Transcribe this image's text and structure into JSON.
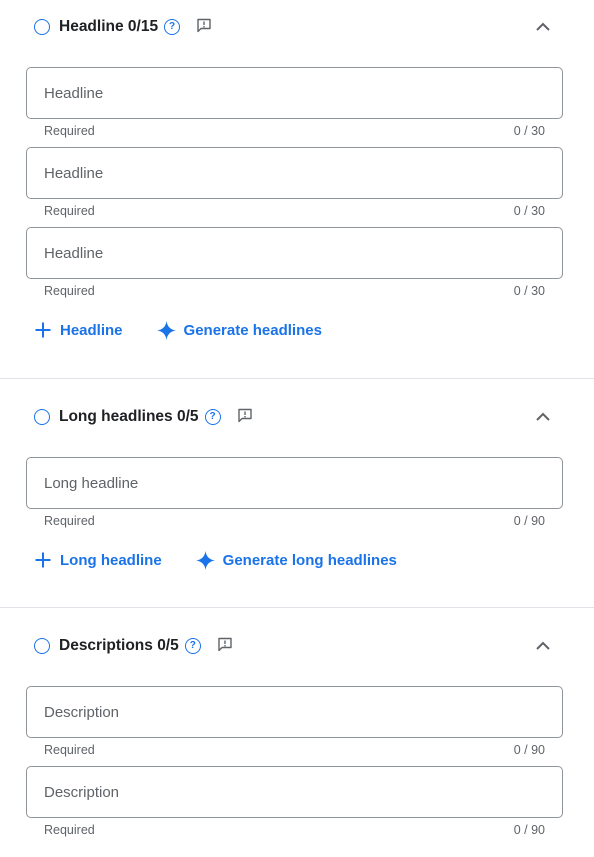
{
  "headline_section": {
    "title": "Headline 0/15",
    "fields": [
      {
        "placeholder": "Headline",
        "hint": "Required",
        "counter": "0 / 30"
      },
      {
        "placeholder": "Headline",
        "hint": "Required",
        "counter": "0 / 30"
      },
      {
        "placeholder": "Headline",
        "hint": "Required",
        "counter": "0 / 30"
      }
    ],
    "add_label": "Headline",
    "generate_label": "Generate headlines"
  },
  "long_headlines_section": {
    "title": "Long headlines 0/5",
    "fields": [
      {
        "placeholder": "Long headline",
        "hint": "Required",
        "counter": "0 / 90"
      }
    ],
    "add_label": "Long headline",
    "generate_label": "Generate long headlines"
  },
  "descriptions_section": {
    "title": "Descriptions 0/5",
    "fields": [
      {
        "placeholder": "Description",
        "hint": "Required",
        "counter": "0 / 90"
      },
      {
        "placeholder": "Description",
        "hint": "Required",
        "counter": "0 / 90"
      }
    ]
  },
  "help_glyph": "?",
  "icons": [
    "radio-button-icon",
    "help-icon",
    "feedback-icon",
    "chevron-up-icon",
    "plus-icon",
    "sparkle-icon"
  ],
  "colors": {
    "accent": "#1a73e8",
    "text": "#202124",
    "muted": "#5f6368",
    "border": "#8f9499",
    "divider": "#e0e3e7"
  }
}
